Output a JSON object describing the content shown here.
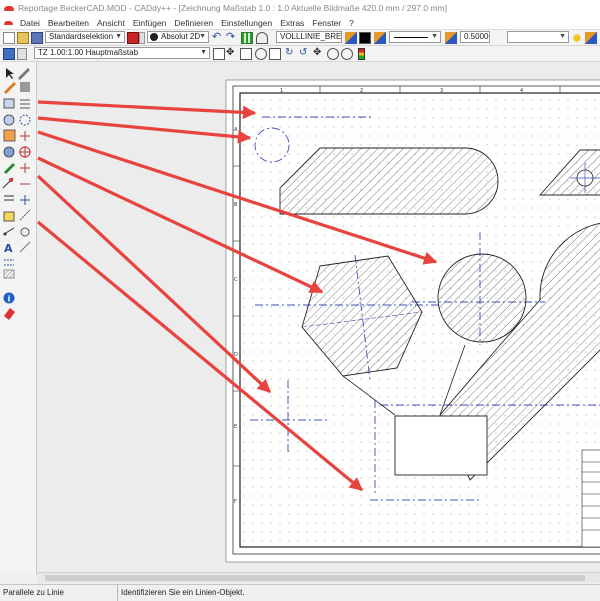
{
  "window": {
    "title": "Reportage BeckerCAD.MOD  -  CADdy++ - [Zeichnung   Maßstab 1.0 : 1.0   Aktuelle Bildmaße 420.0 mm / 297.0 mm]"
  },
  "menu": {
    "items": [
      "Datei",
      "Bearbeiten",
      "Ansicht",
      "Einfügen",
      "Definieren",
      "Einstellungen",
      "Extras",
      "Fenster",
      "?"
    ]
  },
  "toolbar": {
    "selection_mode": "Standardselektion",
    "coordinate_mode": "Absolut 2D",
    "line_type": "VOLLLINIE_BREIT",
    "line_width": "0.500000",
    "scale_part": "TZ 1.00:1.00 Hauptmaßstab"
  },
  "ruler": {
    "top_numbers": [
      "1",
      "2",
      "3",
      "4"
    ],
    "side_letters": [
      "A",
      "B",
      "C",
      "D",
      "E",
      "F"
    ]
  },
  "status": {
    "function": "Parallele zu Linie",
    "prompt": "Identifizieren Sie ein Linien-Objekt."
  },
  "colors": {
    "arrow": "#e8433f",
    "construction_line": "#3b4fb8",
    "hatch": "#444444"
  },
  "icons": [
    "new-icon",
    "open-icon",
    "save-icon",
    "undo-icon",
    "redo-icon",
    "grid-icon",
    "view-icon",
    "layer-icon",
    "color-icon",
    "lightbulb-icon",
    "traffic-light-icon"
  ]
}
